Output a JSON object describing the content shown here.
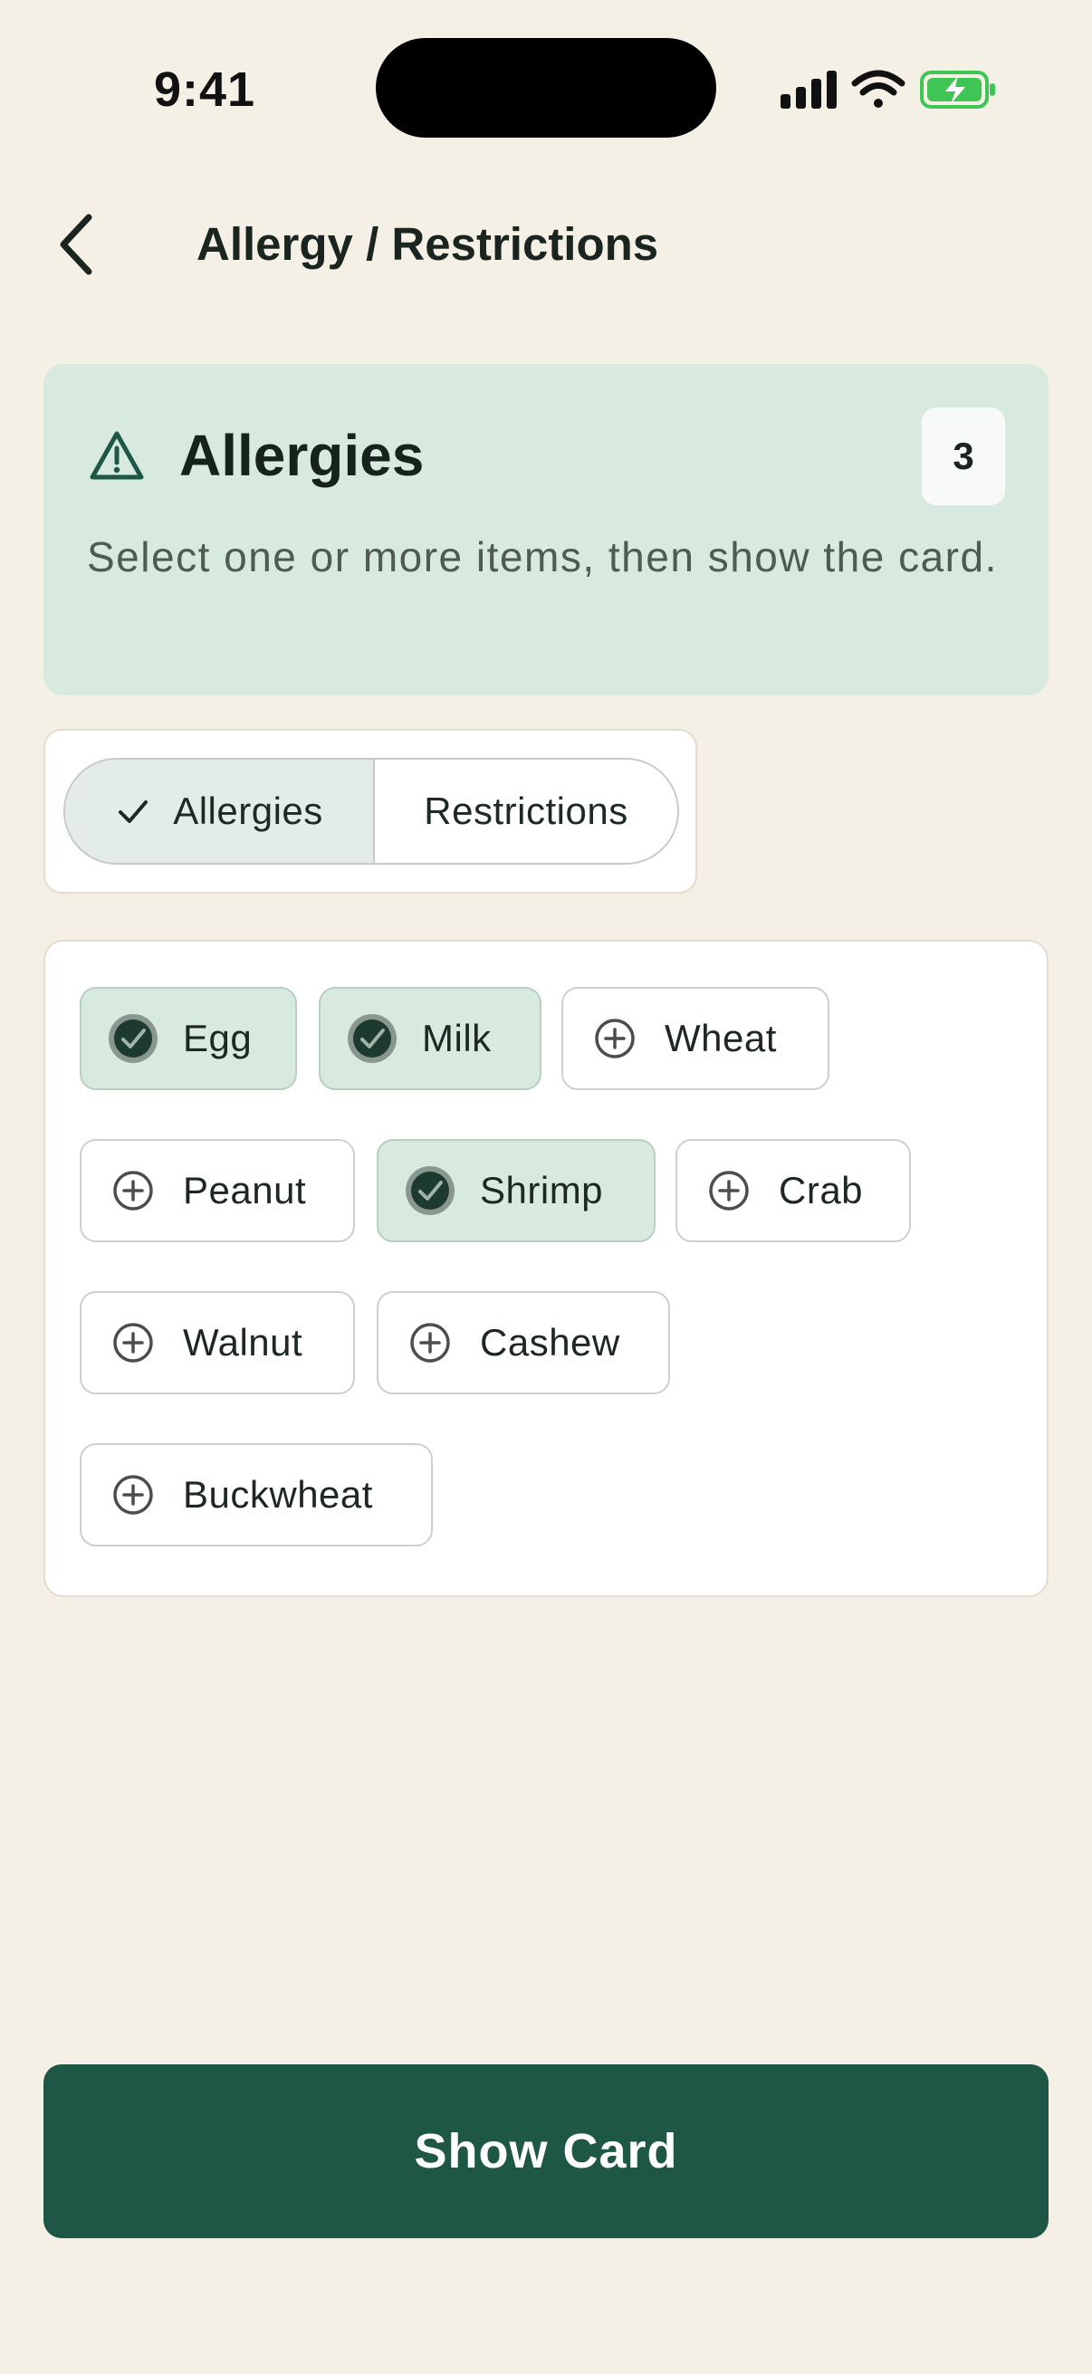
{
  "status_bar": {
    "time": "9:41",
    "icons": [
      "signal-icon",
      "wifi-icon",
      "battery-charging-icon"
    ]
  },
  "header": {
    "title": "Allergy / Restrictions",
    "back_icon": "chevron-left-icon"
  },
  "info_card": {
    "icon": "warning-triangle-icon",
    "title": "Allergies",
    "count": "3",
    "description": "Select one or more items, then show the card."
  },
  "segment": {
    "options": [
      {
        "label": "Allergies",
        "selected": true
      },
      {
        "label": "Restrictions",
        "selected": false
      }
    ]
  },
  "chips": [
    {
      "label": "Egg",
      "selected": true
    },
    {
      "label": "Milk",
      "selected": true
    },
    {
      "label": "Wheat",
      "selected": false
    },
    {
      "label": "Peanut",
      "selected": false
    },
    {
      "label": "Shrimp",
      "selected": true
    },
    {
      "label": "Crab",
      "selected": false
    },
    {
      "label": "Walnut",
      "selected": false
    },
    {
      "label": "Cashew",
      "selected": false
    },
    {
      "label": "Buckwheat",
      "selected": false
    }
  ],
  "cta": {
    "label": "Show Card"
  },
  "colors": {
    "background": "#f5f0e6",
    "accent": "#1f5746",
    "selected_fill": "#d8e9e0",
    "battery": "#3ec553"
  }
}
